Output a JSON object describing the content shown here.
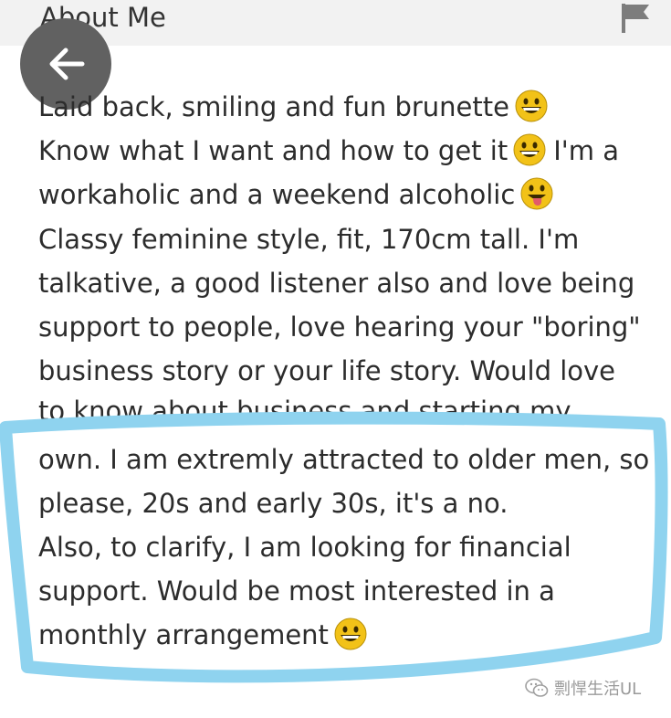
{
  "header": {
    "title": "About Me"
  },
  "bio": {
    "lines": [
      "Laid back, smiling and fun brunette",
      "Know what I want and how to get it",
      "I'm a",
      "workaholic and a weekend alcoholic",
      "Classy feminine style, fit, 170cm tall. I'm",
      "talkative, a good listener also and love being",
      "support to people, love hearing your \"boring\"",
      "business story or your life story. Would love",
      "to know about business and starting my",
      "own. I am extremly attracted to older men, so",
      "please, 20s and early 30s, it's a no.",
      "Also, to clarify, I am looking for financial",
      "support. Would be most interested in a",
      "monthly arrangement"
    ]
  },
  "icons": {
    "back": "arrow-left-icon",
    "flag": "flag-icon",
    "smile": "grinning-face-emoji",
    "tongue": "face-with-tongue-emoji"
  },
  "colors": {
    "highlight": "#8fd3ef",
    "back_button": "#616161",
    "emoji": "#f2c218"
  },
  "watermark": {
    "text": "剽悍生活UL"
  }
}
